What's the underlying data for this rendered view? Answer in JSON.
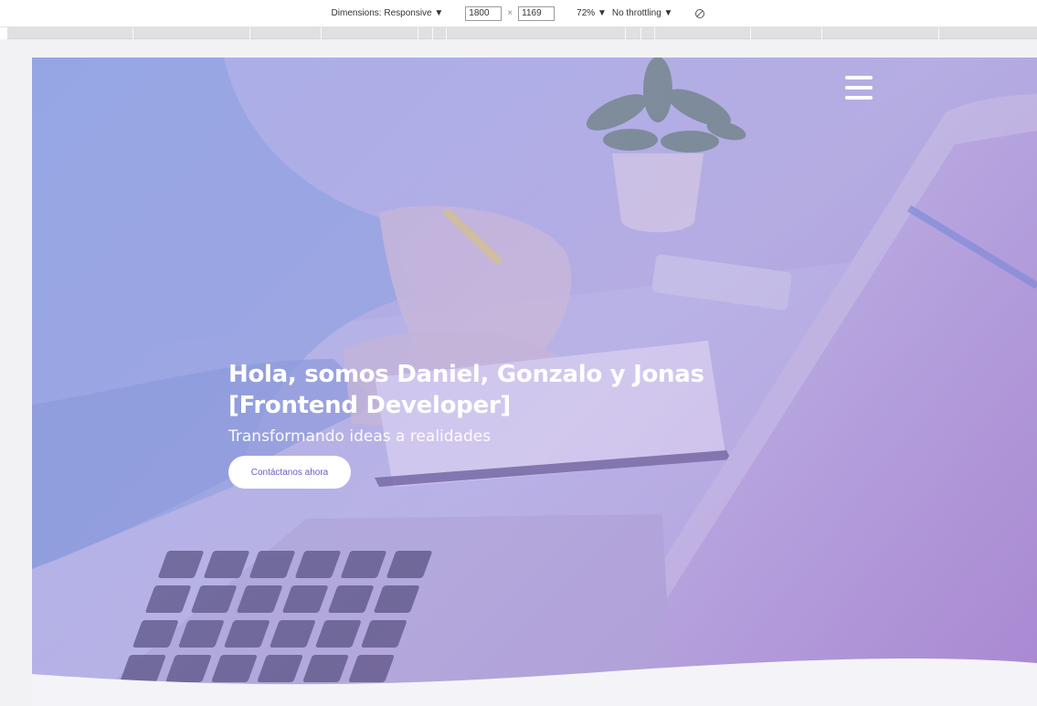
{
  "devtools": {
    "dimensions_label": "Dimensions: Responsive",
    "dropdown_arrow": "▼",
    "width_value": "1800",
    "times": "×",
    "height_value": "1169",
    "zoom_label": "72%",
    "throttling_label": "No throttling",
    "rotate_icon": "rotate-icon"
  },
  "hero": {
    "title_line1": "Hola, somos Daniel, Gonzalo y Jonas",
    "title_line2": "[Frontend Developer]",
    "subtitle": "Transformando ideas a realidades",
    "cta_label": "Contáctanos ahora",
    "menu_icon": "hamburger-menu-icon"
  },
  "colors": {
    "overlay": "#a7a3de",
    "cta_text": "#6a5fc6",
    "page_bg": "#f2f2f4"
  }
}
